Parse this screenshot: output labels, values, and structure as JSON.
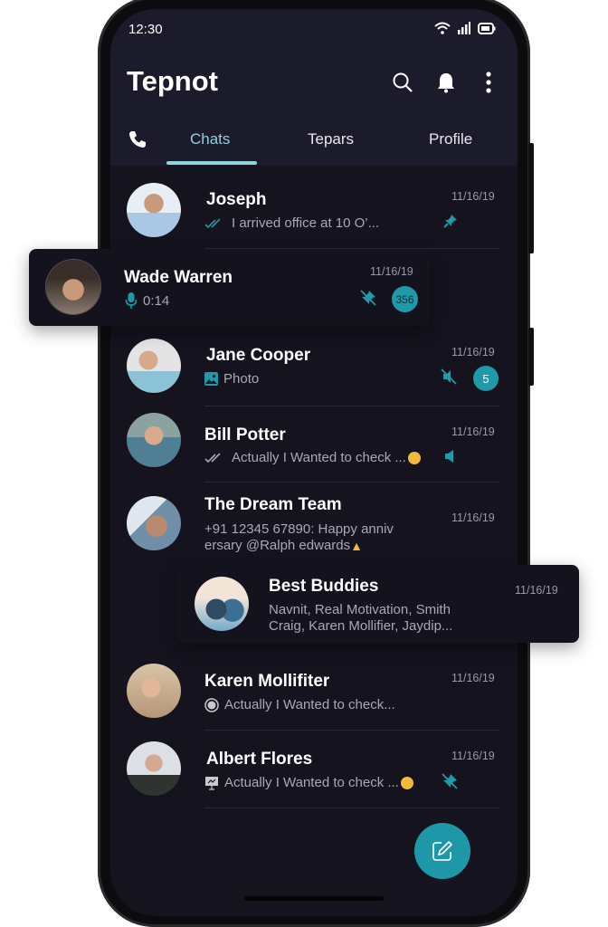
{
  "status_bar": {
    "time": "12:30",
    "icons": [
      "wifi-icon",
      "signal-icon",
      "battery-icon"
    ]
  },
  "app": {
    "title": "Tepnot",
    "actions": [
      "search-icon",
      "bell-icon",
      "more-vertical-icon"
    ]
  },
  "tabs": [
    {
      "label": "Chats",
      "active": true
    },
    {
      "label": "Tepars",
      "active": false
    },
    {
      "label": "Profile",
      "active": false
    }
  ],
  "colors": {
    "accent": "#1e9aab",
    "active_tab": "#8fd3dc",
    "header_bg": "#1b1b2b",
    "list_bg": "#14131e"
  },
  "chats": [
    {
      "name": "Joseph",
      "message": "I arrived office at 10 O’...",
      "date": "11/16/19",
      "status_icon": "double-check-icon",
      "trailing": [
        "pin-icon"
      ]
    },
    {
      "name": "Wade Warren",
      "message": "0:14",
      "date": "11/16/19",
      "status_icon": "microphone-icon",
      "trailing": [
        "unpin-icon"
      ],
      "unread": "356"
    },
    {
      "name": "Jane Cooper",
      "message": "Photo",
      "date": "11/16/19",
      "status_icon": "image-icon",
      "trailing": [
        "mute-icon"
      ],
      "unread": "5"
    },
    {
      "name": "Bill Potter",
      "message": "Actually I Wanted to check ...",
      "date": "11/16/19",
      "status_icon": "double-check-icon",
      "emoji": "smile-emoji",
      "trailing": [
        "speaker-icon"
      ]
    },
    {
      "name": "The Dream Team",
      "message_line1": "+91 12345 67890: Happy anniv",
      "message_line2": "ersary @Ralph edwards",
      "emoji": "thumbs-up-emoji",
      "date": "11/16/19"
    },
    {
      "name": "Best Buddies",
      "message_line1": "Navnit, Real Motivation, Smith",
      "message_line2": "Craig, Karen Mollifier, Jaydip...",
      "date": "11/16/19"
    },
    {
      "name": "Karen Mollifiter",
      "message": "Actually I Wanted to check...",
      "date": "11/16/19",
      "status_icon": "live-location-icon"
    },
    {
      "name": "Albert Flores",
      "message": "Actually I Wanted to check ...",
      "date": "11/16/19",
      "status_icon": "presentation-icon",
      "emoji": "smile-emoji",
      "trailing": [
        "unpin-icon"
      ]
    }
  ],
  "fab": {
    "icon": "compose-icon"
  }
}
